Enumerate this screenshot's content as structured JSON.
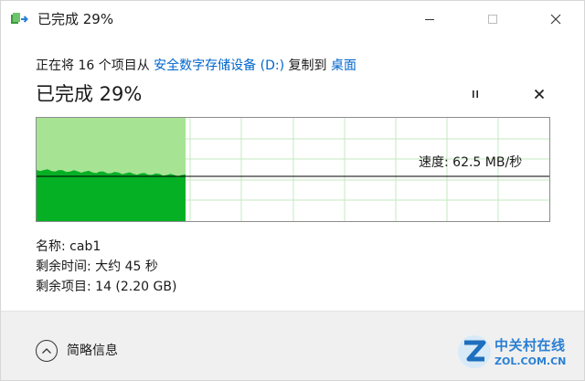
{
  "window": {
    "title": "已完成 29%",
    "icon": "file-copy-icon"
  },
  "copy_line": {
    "prefix": "正在将 16 个项目从 ",
    "source": "安全数字存储设备 (D:)",
    "middle": " 复制到 ",
    "destination": "桌面"
  },
  "progress": {
    "title": "已完成 29%",
    "percent": 29,
    "speed_label": "速度: 62.5 MB/秒"
  },
  "details": {
    "name_label": "名称: ",
    "name_value": "cab1",
    "time_label": "剩余时间: ",
    "time_value": "大约 45 秒",
    "items_label": "剩余项目: ",
    "items_value": "14 (2.20 GB)"
  },
  "footer": {
    "less_details_label": "简略信息"
  },
  "watermark": {
    "line1": "中关村在线",
    "line2": "ZOL.COM.CN"
  },
  "colors": {
    "accent_link": "#0066cc",
    "graph_fill_light": "#a6e494",
    "graph_fill_dark": "#06b025",
    "graph_grid": "#c6e9c0",
    "graph_border": "#8c8c8c",
    "footer_bg": "#f0f0f0"
  },
  "icons": {
    "minimize": "minimize-icon",
    "maximize": "maximize-icon",
    "close": "close-icon",
    "pause": "pause-icon",
    "cancel": "cancel-icon",
    "chevron": "chevron-up-icon"
  }
}
